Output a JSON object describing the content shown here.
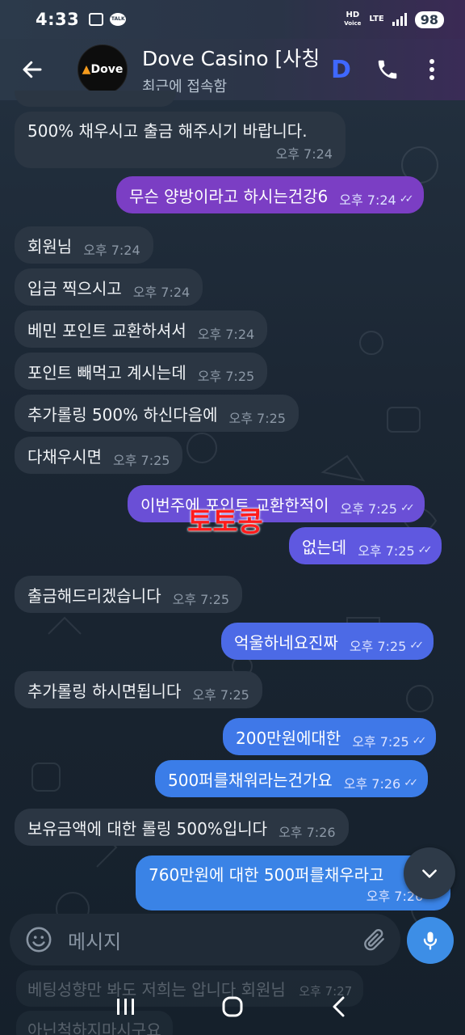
{
  "status_bar": {
    "time": "4:33",
    "talk_label": "TALK",
    "hd_label": "HD",
    "voice_label": "Voice",
    "lte_label": "LTE",
    "battery": "98"
  },
  "header": {
    "title": "Dove Casino [사칭",
    "badge": "D",
    "subtitle": "최근에 접속함",
    "avatar_text": "Dove"
  },
  "messages": [
    {
      "dir": "in",
      "text": "500% 채우시고 출금 해주시기 바랍니다.",
      "time": "오후 7:24"
    },
    {
      "dir": "out",
      "text": "무슨 양방이라고 하시는건강6",
      "time": "오후 7:24",
      "color": "#7b3ec4"
    },
    {
      "dir": "in",
      "text": "회원님",
      "time": "오후 7:24"
    },
    {
      "dir": "in",
      "text": "입금 찍으시고",
      "time": "오후 7:24"
    },
    {
      "dir": "in",
      "text": "베민 포인트 교환하셔서",
      "time": "오후 7:24"
    },
    {
      "dir": "in",
      "text": "포인트 빼먹고 계시는데",
      "time": "오후 7:25"
    },
    {
      "dir": "in",
      "text": "추가롤링 500% 하신다음에",
      "time": "오후 7:25"
    },
    {
      "dir": "in",
      "text": "다채우시면",
      "time": "오후 7:25"
    },
    {
      "dir": "out",
      "text": "이번주에 포인트 교환한적이",
      "time": "오후 7:25",
      "color": "#6a4fd6"
    },
    {
      "dir": "out",
      "text": "없는데",
      "time": "오후 7:25",
      "color": "#5f58e0"
    },
    {
      "dir": "in",
      "text": "출금해드리겠습니다",
      "time": "오후 7:25"
    },
    {
      "dir": "out",
      "text": "억울하네요진짜",
      "time": "오후 7:25",
      "color": "#4c6ae6"
    },
    {
      "dir": "in",
      "text": "추가롤링 하시면됩니다",
      "time": "오후 7:25"
    },
    {
      "dir": "out",
      "text": "200만원에대한",
      "time": "오후 7:25",
      "color": "#3f78e8"
    },
    {
      "dir": "out",
      "text": "500퍼를채워라는건가요",
      "time": "오후 7:26",
      "color": "#3b7de8"
    },
    {
      "dir": "in",
      "text": "보유금액에 대한 롤링 500%입니다",
      "time": "오후 7:26"
    },
    {
      "dir": "out",
      "text": "760만원에 대한 500퍼를채우라고",
      "time": "오후 7:26",
      "color": "#3a83e6"
    }
  ],
  "watermark": "토토콩",
  "ghost_messages": [
    {
      "text": "베팅성향만 봐도 저희는 압니다 회원님",
      "time": "오후 7:27"
    },
    {
      "text": "아닌척하지마시구요",
      "time": ""
    }
  ],
  "input": {
    "placeholder": "메시지"
  },
  "icons": {
    "back": "arrow-left-icon",
    "phone": "phone-icon",
    "more": "more-vertical-icon",
    "emoji": "smiley-icon",
    "attach": "paperclip-icon",
    "mic": "microphone-icon",
    "scroll_down": "chevron-down-icon"
  }
}
